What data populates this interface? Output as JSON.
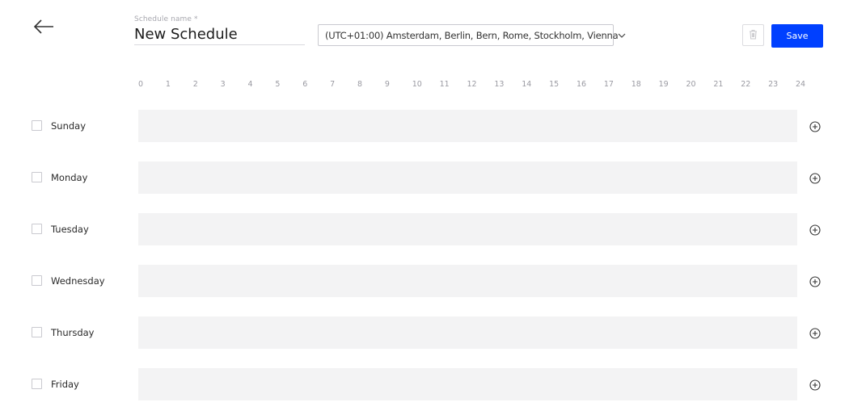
{
  "header": {
    "back_icon": "arrow-left-icon",
    "name_label": "Schedule name *",
    "name_value": "New Schedule",
    "timezone": "(UTC+01:00) Amsterdam, Berlin, Bern, Rome, Stockholm, Vienna",
    "timezone_icon": "chevron-down-icon",
    "delete_icon": "trash-icon",
    "delete_enabled": false,
    "save_label": "Save",
    "accent_color": "#0040ff"
  },
  "hours": [
    "0",
    "1",
    "2",
    "3",
    "4",
    "5",
    "6",
    "7",
    "8",
    "9",
    "10",
    "11",
    "12",
    "13",
    "14",
    "15",
    "16",
    "17",
    "18",
    "19",
    "20",
    "21",
    "22",
    "23",
    "24"
  ],
  "days": [
    {
      "label": "Sunday",
      "checked": false
    },
    {
      "label": "Monday",
      "checked": false
    },
    {
      "label": "Tuesday",
      "checked": false
    },
    {
      "label": "Wednesday",
      "checked": false
    },
    {
      "label": "Thursday",
      "checked": false
    },
    {
      "label": "Friday",
      "checked": false
    }
  ],
  "add_icon": "plus-circle-icon"
}
